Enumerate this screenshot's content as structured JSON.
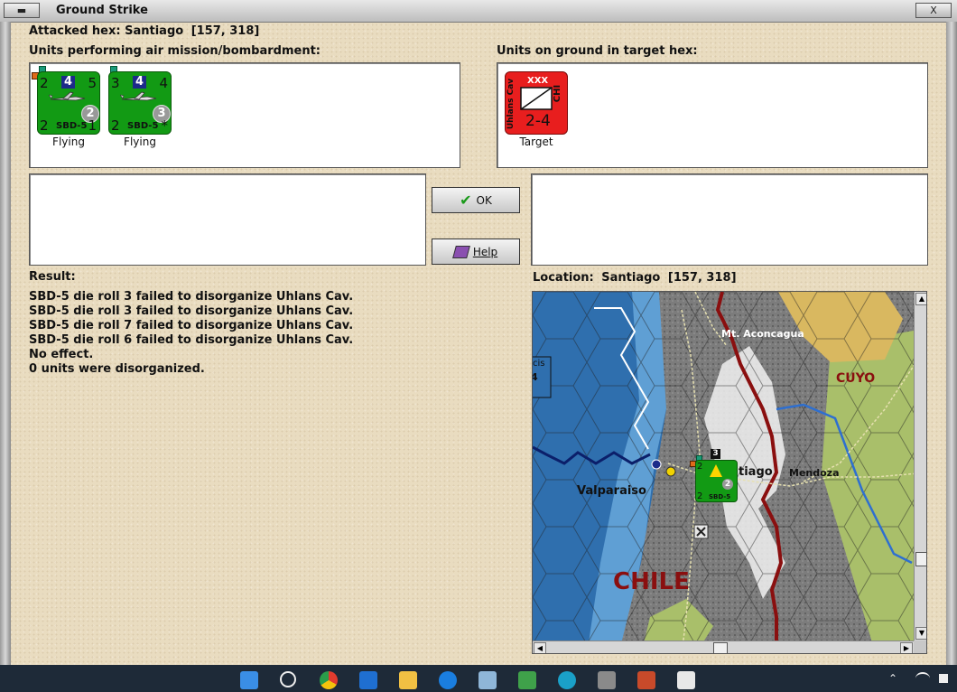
{
  "window": {
    "title": "Ground Strike",
    "min_btn": "▬",
    "close_btn": "X"
  },
  "attacked": {
    "label": "Attacked hex:",
    "place": "Santiago",
    "coords": "[157, 318]"
  },
  "air_units": {
    "heading": "Units performing air mission/bombardment:",
    "units": [
      {
        "top_left": "2",
        "box": "4",
        "top_right": "5",
        "circle": "2",
        "bottom_left": "2",
        "bottom_right": "1",
        "name": "SBD-5",
        "status": "Flying"
      },
      {
        "top_left": "3",
        "box": "4",
        "top_right": "4",
        "circle": "3",
        "bottom_left": "2",
        "bottom_right": "*",
        "name": "SBD-5",
        "status": "Flying"
      }
    ]
  },
  "ground_units": {
    "heading": "Units on ground in target hex:",
    "units": [
      {
        "side_left": "Uhlans Cav",
        "size": "XXX",
        "side_right": "CHI",
        "strength": "2-4",
        "status": "Target"
      }
    ]
  },
  "buttons": {
    "ok": "OK",
    "help": "Help"
  },
  "result": {
    "heading": "Result:",
    "lines": [
      "SBD-5 die roll 3 failed to disorganize Uhlans Cav.",
      "SBD-5 die roll 3 failed to disorganize Uhlans Cav.",
      "SBD-5 die roll 7 failed to disorganize Uhlans Cav.",
      "SBD-5 die roll 6 failed to disorganize Uhlans Cav.",
      "No effect.",
      "0 units were disorganized."
    ]
  },
  "location": {
    "label": "Location:",
    "place": "Santiago",
    "coords": "[157, 318]"
  },
  "map": {
    "labels": {
      "aconcagua": "Mt. Aconcagua",
      "cuyo": "CUYO",
      "santiago": "tiago",
      "mendoza": "Mendoza",
      "valparaiso": "Valparaiso",
      "chile": "CHILE",
      "left_box_a": "cis",
      "left_box_b": "4",
      "stack_count": "3",
      "map_unit_tl": "2",
      "map_unit_bl": "2",
      "map_unit_circle": "2",
      "map_unit_name": "SBD-5"
    },
    "colors": {
      "sea": "#2f6fae",
      "coast": "#5f9fd4",
      "mountain": "#7d7d7d",
      "desert": "#d9b860",
      "grass": "#a9bf6a",
      "border": "#8a0f0f"
    }
  }
}
